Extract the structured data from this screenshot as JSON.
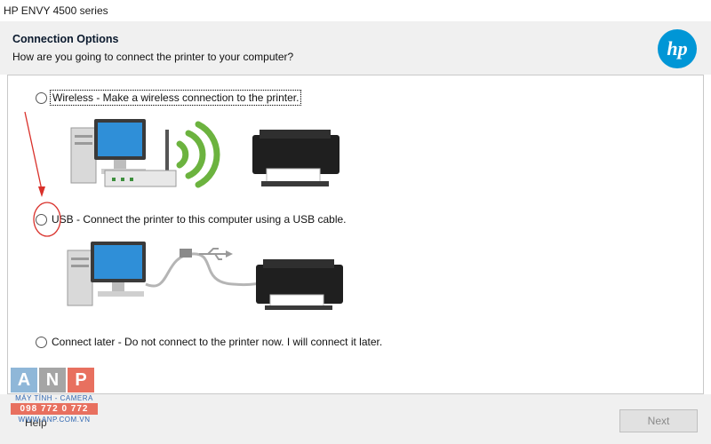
{
  "window": {
    "title": "HP ENVY 4500 series"
  },
  "header": {
    "title": "Connection Options",
    "subtitle": "How are you going to connect the printer to your computer?"
  },
  "options": [
    {
      "id": "wireless",
      "label": "Wireless - Make a wireless connection to the printer.",
      "selected": false
    },
    {
      "id": "usb",
      "label": "USB - Connect the printer to this computer using a USB cable.",
      "selected": false
    },
    {
      "id": "later",
      "label": "Connect later - Do not connect to the printer now. I will connect it later.",
      "selected": false
    }
  ],
  "footer": {
    "help_label": "Help",
    "next_label": "Next",
    "next_enabled": false
  },
  "watermark": {
    "letters": [
      "A",
      "N",
      "P"
    ],
    "tagline": "MÁY TÍNH - CAMERA",
    "phone": "098 772 0 772",
    "url": "WWW.ANP.COM.VN"
  },
  "logo": {
    "text": "hp"
  },
  "colors": {
    "hp_blue": "#0096d6",
    "annotation_red": "#d9302a",
    "wifi_green": "#6cb33f",
    "panel_gray": "#f0f0f0"
  }
}
